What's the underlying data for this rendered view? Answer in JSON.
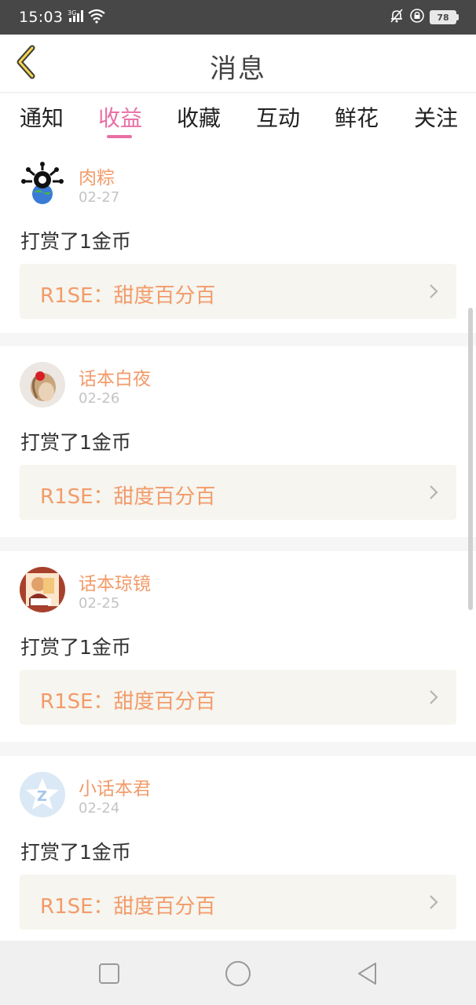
{
  "status_bar": {
    "time": "15:03",
    "network": "3G",
    "battery": "78"
  },
  "header": {
    "title": "消息",
    "back_icon": "chevron-left-icon"
  },
  "tabs": [
    {
      "label": "通知",
      "active": false
    },
    {
      "label": "收益",
      "active": true
    },
    {
      "label": "收藏",
      "active": false
    },
    {
      "label": "互动",
      "active": false
    },
    {
      "label": "鲜花",
      "active": false
    },
    {
      "label": "关注",
      "active": false
    }
  ],
  "messages": [
    {
      "user": "肉粽",
      "date": "02-27",
      "action": "打赏了1金币",
      "reference": "R1SE：甜度百分百",
      "avatar": "avatar-virus-earth"
    },
    {
      "user": "话本白夜",
      "date": "02-26",
      "action": "打赏了1金币",
      "reference": "R1SE：甜度百分百",
      "avatar": "avatar-girl-red-bow"
    },
    {
      "user": "话本琼镜",
      "date": "02-25",
      "action": "打赏了1金币",
      "reference": "R1SE：甜度百分百",
      "avatar": "avatar-cartoon-character"
    },
    {
      "user": "小话本君",
      "date": "02-24",
      "action": "打赏了1金币",
      "reference": "R1SE：甜度百分百",
      "avatar": "avatar-z-star-logo"
    }
  ],
  "colors": {
    "accent_pink": "#e96fa4",
    "name_orange": "#f29b6a",
    "ref_bg": "#f6f5ef"
  },
  "nav_bar": [
    "square-icon",
    "circle-icon",
    "triangle-back-icon"
  ]
}
